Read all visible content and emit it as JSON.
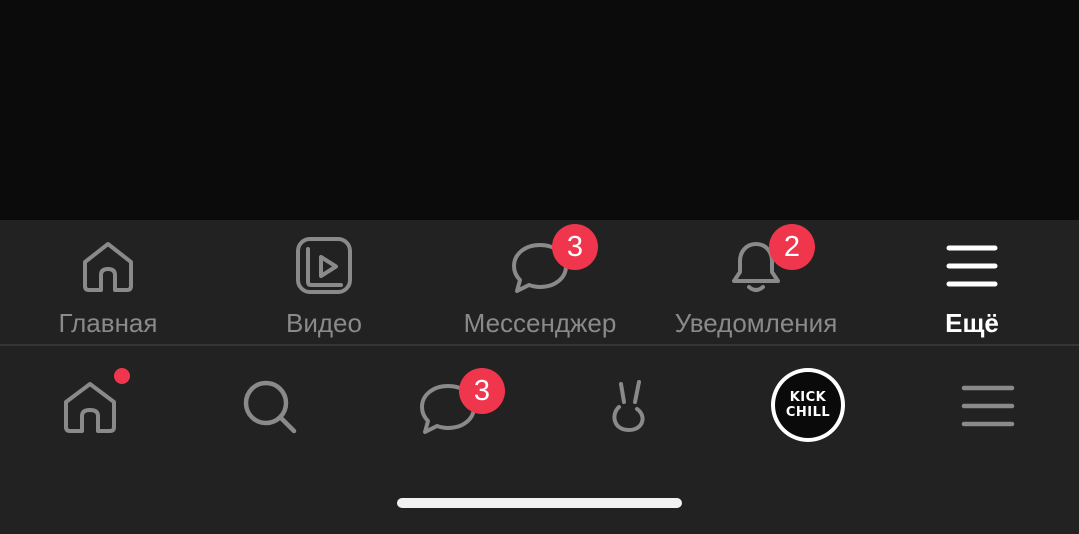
{
  "colors": {
    "background": "#0b0b0b",
    "bar": "#222222",
    "inactive": "#8a8a8a",
    "active": "#ffffff",
    "badge": "#f0364d"
  },
  "top_tabs": [
    {
      "label": "Главная",
      "icon": "home-icon"
    },
    {
      "label": "Видео",
      "icon": "video-icon"
    },
    {
      "label": "Мессенджер",
      "icon": "message-icon",
      "badge": "3"
    },
    {
      "label": "Уведомления",
      "icon": "bell-icon",
      "badge": "2"
    },
    {
      "label": "Ещё",
      "icon": "menu-icon",
      "active": true
    }
  ],
  "bottom_nav": [
    {
      "icon": "home-icon",
      "has_dot": true
    },
    {
      "icon": "search-icon"
    },
    {
      "icon": "message-icon",
      "badge": "3"
    },
    {
      "icon": "clips-icon"
    },
    {
      "icon": "profile-avatar",
      "avatar_text": "KICK CHILL"
    },
    {
      "icon": "menu-icon"
    }
  ]
}
